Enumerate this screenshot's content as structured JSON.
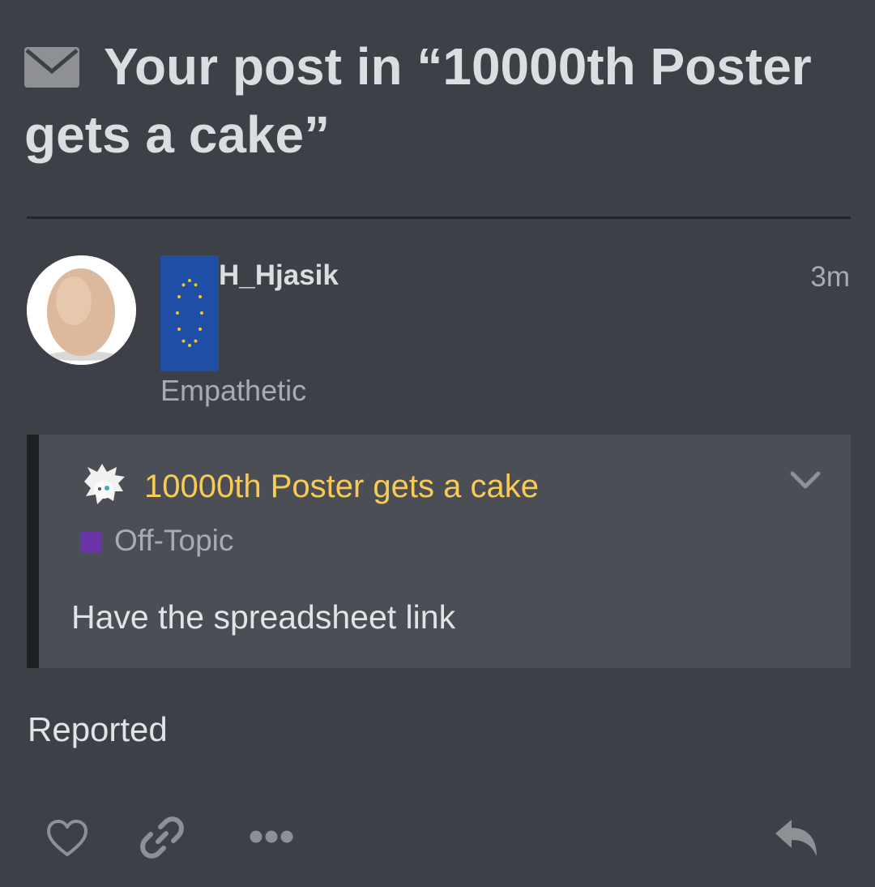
{
  "header": {
    "icon": "envelope-icon",
    "title": "Your post in “10000th Poster gets a cake”"
  },
  "post": {
    "avatar": "egg-avatar",
    "flair": "eu-flag-flair",
    "username": "H_Hjasik",
    "time": "3m",
    "user_title": "Empathetic"
  },
  "quote": {
    "avatar": "white-haired-character-avatar",
    "topic_title": "10000th Poster gets a cake",
    "category": {
      "name": "Off-Topic",
      "color": "#6a35a8"
    },
    "body": "Have the spreadsheet link",
    "expand_icon": "chevron-down-icon"
  },
  "status": "Reported",
  "actions": {
    "like_icon": "heart-icon",
    "link_icon": "link-icon",
    "more_icon": "ellipsis-icon",
    "reply_icon": "reply-icon"
  },
  "colors": {
    "background": "#3e4048",
    "quote_background": "#4c4e55",
    "topic_title": "#f8cb54",
    "flair_blue": "#1f4ea6",
    "flair_star": "#f2c90f"
  }
}
